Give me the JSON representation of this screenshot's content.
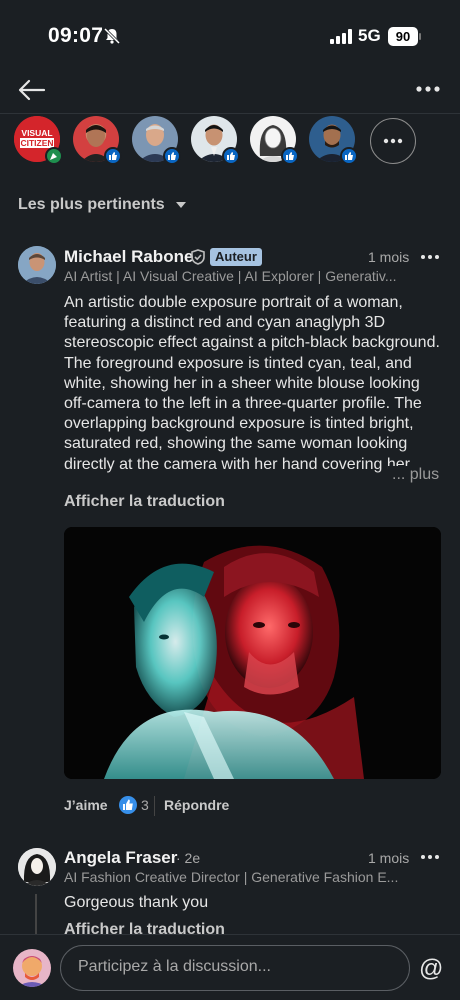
{
  "status_bar": {
    "time": "09:07",
    "network": "5G",
    "battery": "90"
  },
  "icons": {
    "back": "arrow-left-icon",
    "more": "more-horizontal-icon",
    "verified": "shield-check-icon",
    "like": "thumbs-up-icon",
    "mention": "at-icon"
  },
  "stories": {
    "first_logo_text": "VISUAL CITIZEN"
  },
  "sort": {
    "label": "Les plus pertinents"
  },
  "post_comment": {
    "author": "Michael Rabone",
    "author_tag": "Auteur",
    "time": "1 mois",
    "headline": "AI Artist | AI Visual Creative | AI Explorer | Generativ...",
    "text": "An artistic double exposure portrait of a woman, featuring a distinct red and cyan anaglyph 3D stereoscopic effect against a pitch-black background. The foreground exposure is tinted cyan, teal, and white, showing her in a sheer white blouse looking off-camera to the left in a three-quarter profile. The overlapping background exposure is tinted bright, saturated red, showing the same woman looking directly at the camera with her hand covering her mouth. High",
    "more": "... plus",
    "translate": "Afficher la traduction",
    "like_label": "J’aime",
    "like_count": "3",
    "reply_label": "Répondre"
  },
  "reply_comment": {
    "author": "Angela Fraser",
    "degree": "· 2e",
    "time": "1 mois",
    "headline": "AI Fashion Creative Director | Generative Fashion E...",
    "text": "Gorgeous thank you",
    "translate": "Afficher la traduction"
  },
  "composer": {
    "placeholder": "Participez à la discussion..."
  },
  "colors": {
    "background": "#1b1f23",
    "accent": "#0a66c2",
    "author_tag": "#a6c3e1"
  }
}
